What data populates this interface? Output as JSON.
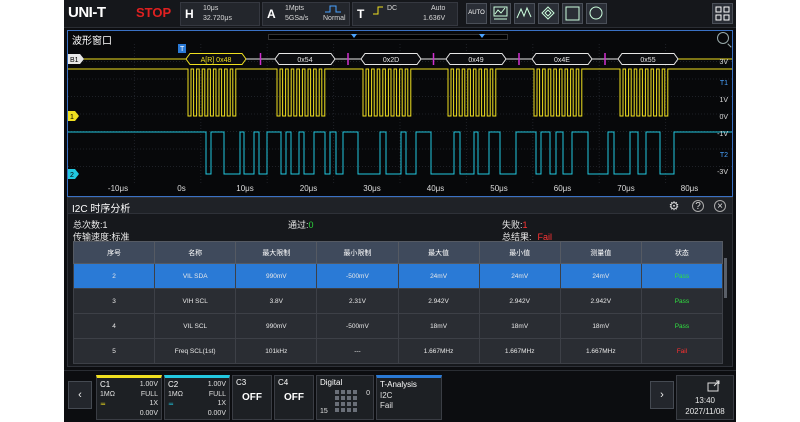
{
  "brand": "UNI-T",
  "run_state": "STOP",
  "horizontal": {
    "letter": "H",
    "timebase": "10μs",
    "delay": "32.720μs"
  },
  "acquire": {
    "letter": "A",
    "depth": "1Mpts",
    "rate": "5GSa/s",
    "mode": "Normal"
  },
  "trigger": {
    "letter": "T",
    "coupling": "DC",
    "sweep": "Auto",
    "level": "1.636V"
  },
  "toolbar": {
    "auto_label": "AUTO"
  },
  "wave_window": {
    "title": "波形窗口",
    "decode_frames": [
      "A[R] 0x48",
      "0x54",
      "0x2D",
      "0x49",
      "0x4E",
      "0x55"
    ],
    "bus_label": "B1",
    "ch1_marker": "1",
    "ch2_marker": "2",
    "trigger_marker": "T",
    "time_labels": [
      "-10μs",
      "0s",
      "10μs",
      "20μs",
      "30μs",
      "40μs",
      "50μs",
      "60μs",
      "70μs",
      "80μs"
    ],
    "right_labels": [
      "3V",
      "T1",
      "1V",
      "0V",
      "-1V",
      "T2",
      "-3V"
    ]
  },
  "analysis": {
    "title": "I2C 时序分析",
    "total_label": "总次数:",
    "total_value": "1",
    "pass_label": "通过:",
    "pass_value": "0",
    "fail_label": "失败:",
    "fail_value": "1",
    "speed_label": "传输速度:",
    "speed_value": "标准",
    "result_label": "总结果:",
    "result_value": "Fail",
    "columns": [
      "序号",
      "名称",
      "最大限制",
      "最小限制",
      "最大值",
      "最小值",
      "测量值",
      "状态"
    ],
    "rows": [
      {
        "no": "2",
        "name": "VIL SDA",
        "max_limit": "990mV",
        "min_limit": "-500mV",
        "max": "24mV",
        "min": "24mV",
        "meas": "24mV",
        "status": "Pass"
      },
      {
        "no": "3",
        "name": "VIH SCL",
        "max_limit": "3.8V",
        "min_limit": "2.31V",
        "max": "2.942V",
        "min": "2.942V",
        "meas": "2.942V",
        "status": "Pass"
      },
      {
        "no": "4",
        "name": "VIL SCL",
        "max_limit": "990mV",
        "min_limit": "-500mV",
        "max": "18mV",
        "min": "18mV",
        "meas": "18mV",
        "status": "Pass"
      },
      {
        "no": "5",
        "name": "Freq SCL(1st)",
        "max_limit": "101kHz",
        "min_limit": "---",
        "max": "1.667MHz",
        "min": "1.667MHz",
        "meas": "1.667MHz",
        "status": "Fail"
      }
    ]
  },
  "channels": {
    "c1": {
      "name": "C1",
      "scale": "1.00V",
      "imp": "1MΩ",
      "bw": "FULL",
      "probe": "1X",
      "offset": "0.00V",
      "color": "#f0e020"
    },
    "c2": {
      "name": "C2",
      "scale": "1.00V",
      "imp": "1MΩ",
      "bw": "FULL",
      "probe": "1X",
      "offset": "0.00V",
      "color": "#22c8e0"
    },
    "c3": {
      "name": "C3",
      "state": "OFF"
    },
    "c4": {
      "name": "C4",
      "state": "OFF"
    },
    "digital": {
      "name": "Digital",
      "hi": "0",
      "lo": "15"
    },
    "t_analysis": {
      "name": "T-Analysis",
      "protocol": "I2C",
      "result": "Fail"
    }
  },
  "clock": {
    "time": "13:40",
    "date": "2027/11/08"
  },
  "colors": {
    "ch1": "#f0e020",
    "ch2": "#22c8e0",
    "decode": "#e8e8e8",
    "accent": "#2a7ad6",
    "pass": "#30e040",
    "fail": "#ff3030"
  }
}
